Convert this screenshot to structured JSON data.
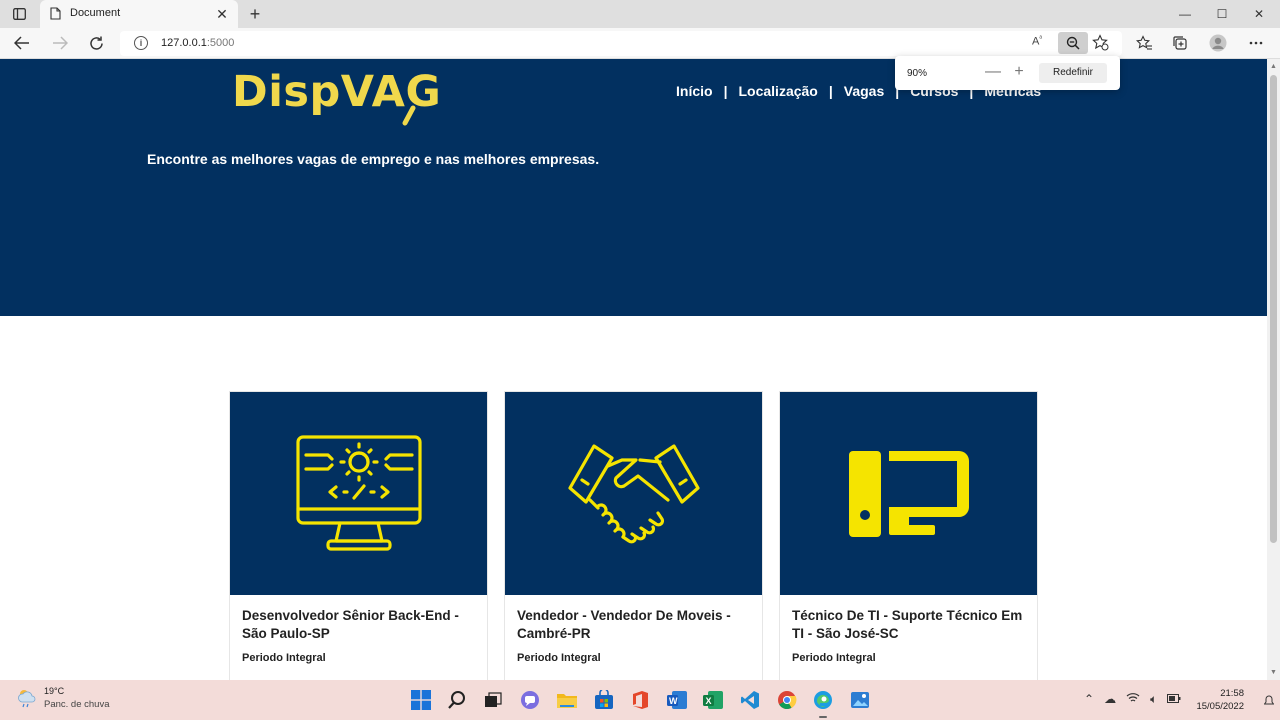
{
  "browser": {
    "tab_title": "Document",
    "tab_close": "✕",
    "new_tab": "+",
    "url_host": "127.0.0.1",
    "url_port": ":5000",
    "zoom_popup": {
      "percent": "90%",
      "minus": "—",
      "plus": "+",
      "reset_label": "Redefinir"
    },
    "window_controls": [
      "—",
      "☐",
      "✕"
    ]
  },
  "site": {
    "logo": "DispVAG",
    "nav": [
      "Início",
      "Localização",
      "Vagas",
      "Cursos",
      "Métricas"
    ],
    "nav_separator": "|",
    "tagline": "Encontre as melhores vagas de emprego e nas melhores empresas.",
    "colors": {
      "hero_bg": "#023060",
      "accent": "#f0d84c",
      "icon_yellow": "#f5e400"
    }
  },
  "jobs": [
    {
      "title": "Desenvolvedor Sênior Back-End - São Paulo-SP",
      "type": "Periodo Integral",
      "icon": "developer-monitor-icon"
    },
    {
      "title": "Vendedor - Vendedor De Moveis - Cambré-PR",
      "type": "Periodo Integral",
      "icon": "handshake-icon"
    },
    {
      "title": "Técnico De TI - Suporte Técnico Em TI - São José-SC",
      "type": "Periodo Integral",
      "icon": "desktop-computer-icon"
    }
  ],
  "taskbar": {
    "weather_temp": "19°C",
    "weather_desc": "Panc. de chuva",
    "time": "21:58",
    "date": "15/05/2022"
  }
}
